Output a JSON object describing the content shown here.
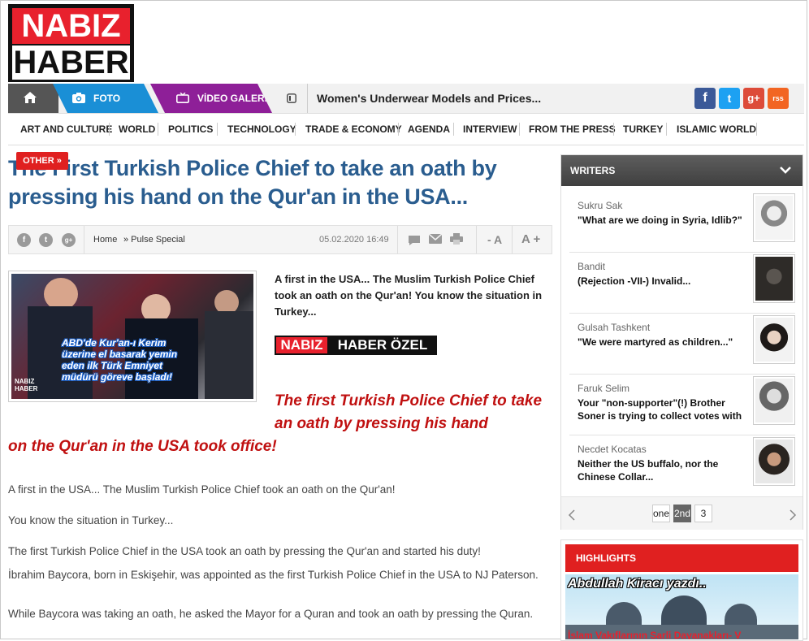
{
  "logo": {
    "top": "NABIZ",
    "bottom": "HABER"
  },
  "topnav": {
    "foto_label": "FOTO GALERİ",
    "video_label": "VİDEO GALERİ",
    "ticker": "Women's Underwear Models and Prices..."
  },
  "social": {
    "facebook": "f",
    "twitter": "t",
    "gplus": "g+",
    "rss": "rss"
  },
  "categories": [
    "ART AND CULTURE",
    "WORLD",
    "POLITICS",
    "TECHNOLOGY",
    "TRADE & ECONOMY",
    "AGENDA",
    "INTERVIEW",
    "FROM THE PRESS",
    "TURKEY",
    "ISLAMIC WORLD"
  ],
  "article": {
    "badge": "OTHER »",
    "title": "The First Turkish Police Chief to take an oath by pressing his hand on the Qur'an in the USA...",
    "breadcrumb_home": "Home",
    "breadcrumb_section": "» Pulse Special",
    "date": "05.02.2020 16:49",
    "font_minus": "- A",
    "font_plus": "A +",
    "photo_caption": "ABD'de Kur'an-ı Kerim üzerine el basarak yemin eden ilk Türk Emniyet müdürü göreve başladı!",
    "photo_logo_top": "NABIZ",
    "photo_logo_bottom": "HABER",
    "lead": "A first in the USA... The Muslim Turkish Police Chief took an oath on the Qur'an! You know the situation in Turkey...",
    "ozel_red": "NABIZ",
    "ozel_white": "HABER ÖZEL",
    "red_line1": "The first Turkish Police Chief to take an oath by pressing his hand",
    "red_line2": "on the Qur'an in the USA took office!",
    "p1": "A first in the USA... The Muslim Turkish Police Chief took an oath on the Qur'an!",
    "p2": "You know the situation in Turkey...",
    "p3": "The first Turkish Police Chief in the USA took an oath by pressing the Qur'an and started his duty!",
    "p4": "İbrahim Baycora, born in Eskişehir, was appointed as the first Turkish Police Chief in the USA to NJ Paterson.",
    "p5": "While Baycora was taking an oath, he asked the Mayor for a Quran and took an oath by pressing the Quran."
  },
  "writers": {
    "heading": "WRITERS",
    "items": [
      {
        "name": "Sukru Sak",
        "title": "\"What are we doing in Syria, Idlib?\""
      },
      {
        "name": "Bandit",
        "title": "(Rejection -VII-) Invalid..."
      },
      {
        "name": "Gulsah Tashkent",
        "title": "\"We were martyred as children...\""
      },
      {
        "name": "Faruk Selim",
        "title": "Your \"non-supporter\"(!) Brother Soner is trying to collect votes with"
      },
      {
        "name": "Necdet Kocatas",
        "title": "Neither the US buffalo, nor the Chinese Collar..."
      }
    ],
    "pages": [
      "one",
      "2nd",
      "3"
    ]
  },
  "highlights": {
    "heading": "HIGHLIGHTS",
    "caption": "Abdullah Kiracı yazdı..",
    "bottom": "İslam Vakıflarının Sarli Dayanakları- V"
  }
}
